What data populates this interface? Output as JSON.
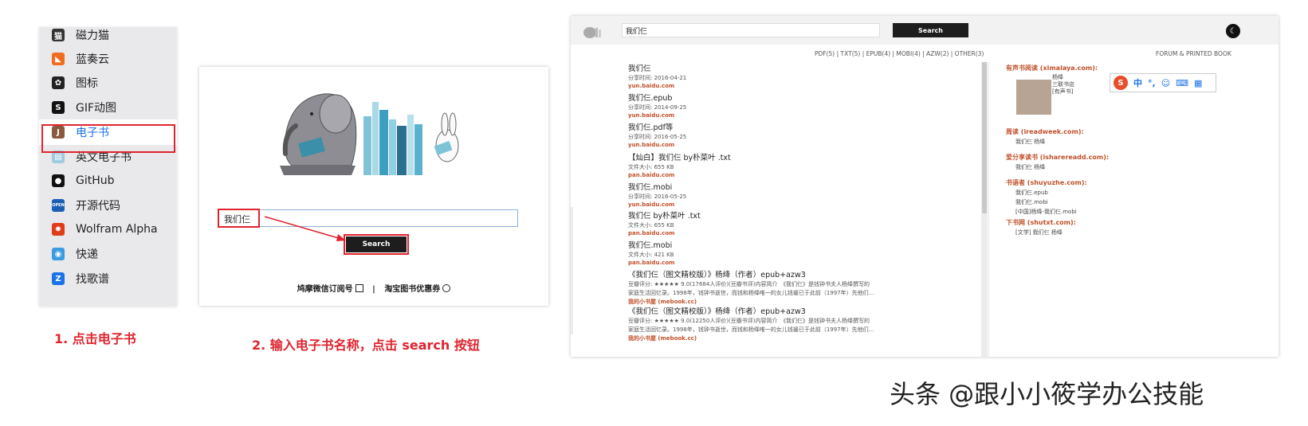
{
  "sidebar": {
    "items": [
      {
        "label": "磁力猫",
        "icon": "cat-icon",
        "color": "#333333",
        "glyph": "猫"
      },
      {
        "label": "蓝奏云",
        "icon": "lanzou-icon",
        "color": "#f26b21",
        "glyph": "◣"
      },
      {
        "label": "图标",
        "icon": "icon-library-icon",
        "color": "#222222",
        "glyph": "✿"
      },
      {
        "label": "GIF动图",
        "icon": "gif-icon",
        "color": "#111111",
        "glyph": "S"
      },
      {
        "label": "电子书",
        "icon": "ebook-icon",
        "color": "#8a5a3c",
        "glyph": "J"
      },
      {
        "label": "英文电子书",
        "icon": "open-book-icon",
        "color": "#9ecbe0",
        "glyph": "▤"
      },
      {
        "label": "GitHub",
        "icon": "github-icon",
        "color": "#111111",
        "glyph": "●"
      },
      {
        "label": "开源代码",
        "icon": "open-source-icon",
        "color": "#1a5fb4",
        "glyph": "OPEN"
      },
      {
        "label": "Wolfram Alpha",
        "icon": "wolfram-icon",
        "color": "#e03c1a",
        "glyph": "✸"
      },
      {
        "label": "快递",
        "icon": "delivery-icon",
        "color": "#3a9be0",
        "glyph": "◉"
      },
      {
        "label": "找歌谱",
        "icon": "music-score-icon",
        "color": "#1a73e8",
        "glyph": "Z"
      }
    ]
  },
  "steps": {
    "step1": "1. 点击电子书",
    "step2": "2. 输入电子书名称，点击 search 按钮"
  },
  "search_page": {
    "query": "我们仨",
    "button": "Search",
    "footer_left": "鸠摩微信订阅号",
    "footer_sep": "|",
    "footer_right": "淘宝图书优惠券"
  },
  "results_page": {
    "query": "我们仨",
    "button": "Search",
    "filters": "PDF(5) | TXT(5) | EPUB(4) | MOBI(4) | AZW(2) | OTHER(3)",
    "forum": "FORUM & PRINTED BOOK",
    "results": [
      {
        "title": "我们仨",
        "meta": "分享时间: 2016-04-21",
        "source": "yun.baidu.com"
      },
      {
        "title": "我们仨.epub",
        "meta": "分享时间: 2014-09-25",
        "source": "yun.baidu.com"
      },
      {
        "title": "我们仨.pdf等",
        "meta": "分享时间: 2016-05-25",
        "source": "yun.baidu.com"
      },
      {
        "title": "【灿白】我们仨 by朴菜叶 .txt",
        "meta": "文件大小: 655 KB",
        "source": "pan.baidu.com"
      },
      {
        "title": "我们仨.mobi",
        "meta": "分享时间: 2016-05-25",
        "source": "yun.baidu.com"
      },
      {
        "title": "我们仨 by朴菜叶 .txt",
        "meta": "文件大小: 655 KB",
        "source": "pan.baidu.com"
      },
      {
        "title": "我们仨.mobi",
        "meta": "文件大小: 421 KB",
        "source": "pan.baidu.com"
      },
      {
        "title": "《我们仨（图文精校版）》杨绛（作者）epub+azw3",
        "meta": "豆瓣评分: ★★★★★ 9.0(17684人评价)(豆瓣书评)内容简介　《我们仨》是钱钟书夫人杨绛撰写的",
        "meta2": "家庭生活回忆录。1998年，钱钟书逝世，而钱和杨绛唯一的女儿钱瑗已于此前（1997年）先他们...",
        "source": "我的小书屋 (mebook.cc)"
      },
      {
        "title": "《我们仨（图文精校版）》杨绛（作者）epub+azw3",
        "meta": "豆瓣评分: ★★★★★ 9.0(12250人评价)(豆瓣书评)内容简介　《我们仨》是钱钟书夫人杨绛撰写的",
        "meta2": "家庭生活回忆录。1998年，钱钟书逝世，而钱和杨绛唯一的女儿钱瑗已于此前（1997年）先他们...",
        "source": "我的小书屋 (mebook.cc)"
      }
    ],
    "side": [
      {
        "heading": "有声书阅读 (ximalaya.com):",
        "items": [
          "杨绛",
          "三联书店",
          "[有声书]"
        ]
      },
      {
        "heading": "周读 (ireadweek.com):",
        "items": [
          "我们仨 杨绛"
        ]
      },
      {
        "heading": "爱分享读书 (isharereadd.com):",
        "items": [
          "我们仨 杨绛"
        ]
      },
      {
        "heading": "书语者 (shuyuzhe.com):",
        "items": [
          "我们仨.epub",
          "我们仨.mobi",
          "[中国]杨绛-我们仨.mobi"
        ]
      },
      {
        "heading": "下书网 (shutxt.com):",
        "items": [
          "[文学] 我们仨 杨绛"
        ]
      }
    ],
    "ime": {
      "logo": "S",
      "items": [
        "中",
        "°,",
        "☺",
        "⌨",
        "▦"
      ]
    }
  },
  "watermark": "头条 @跟小小筱学办公技能"
}
